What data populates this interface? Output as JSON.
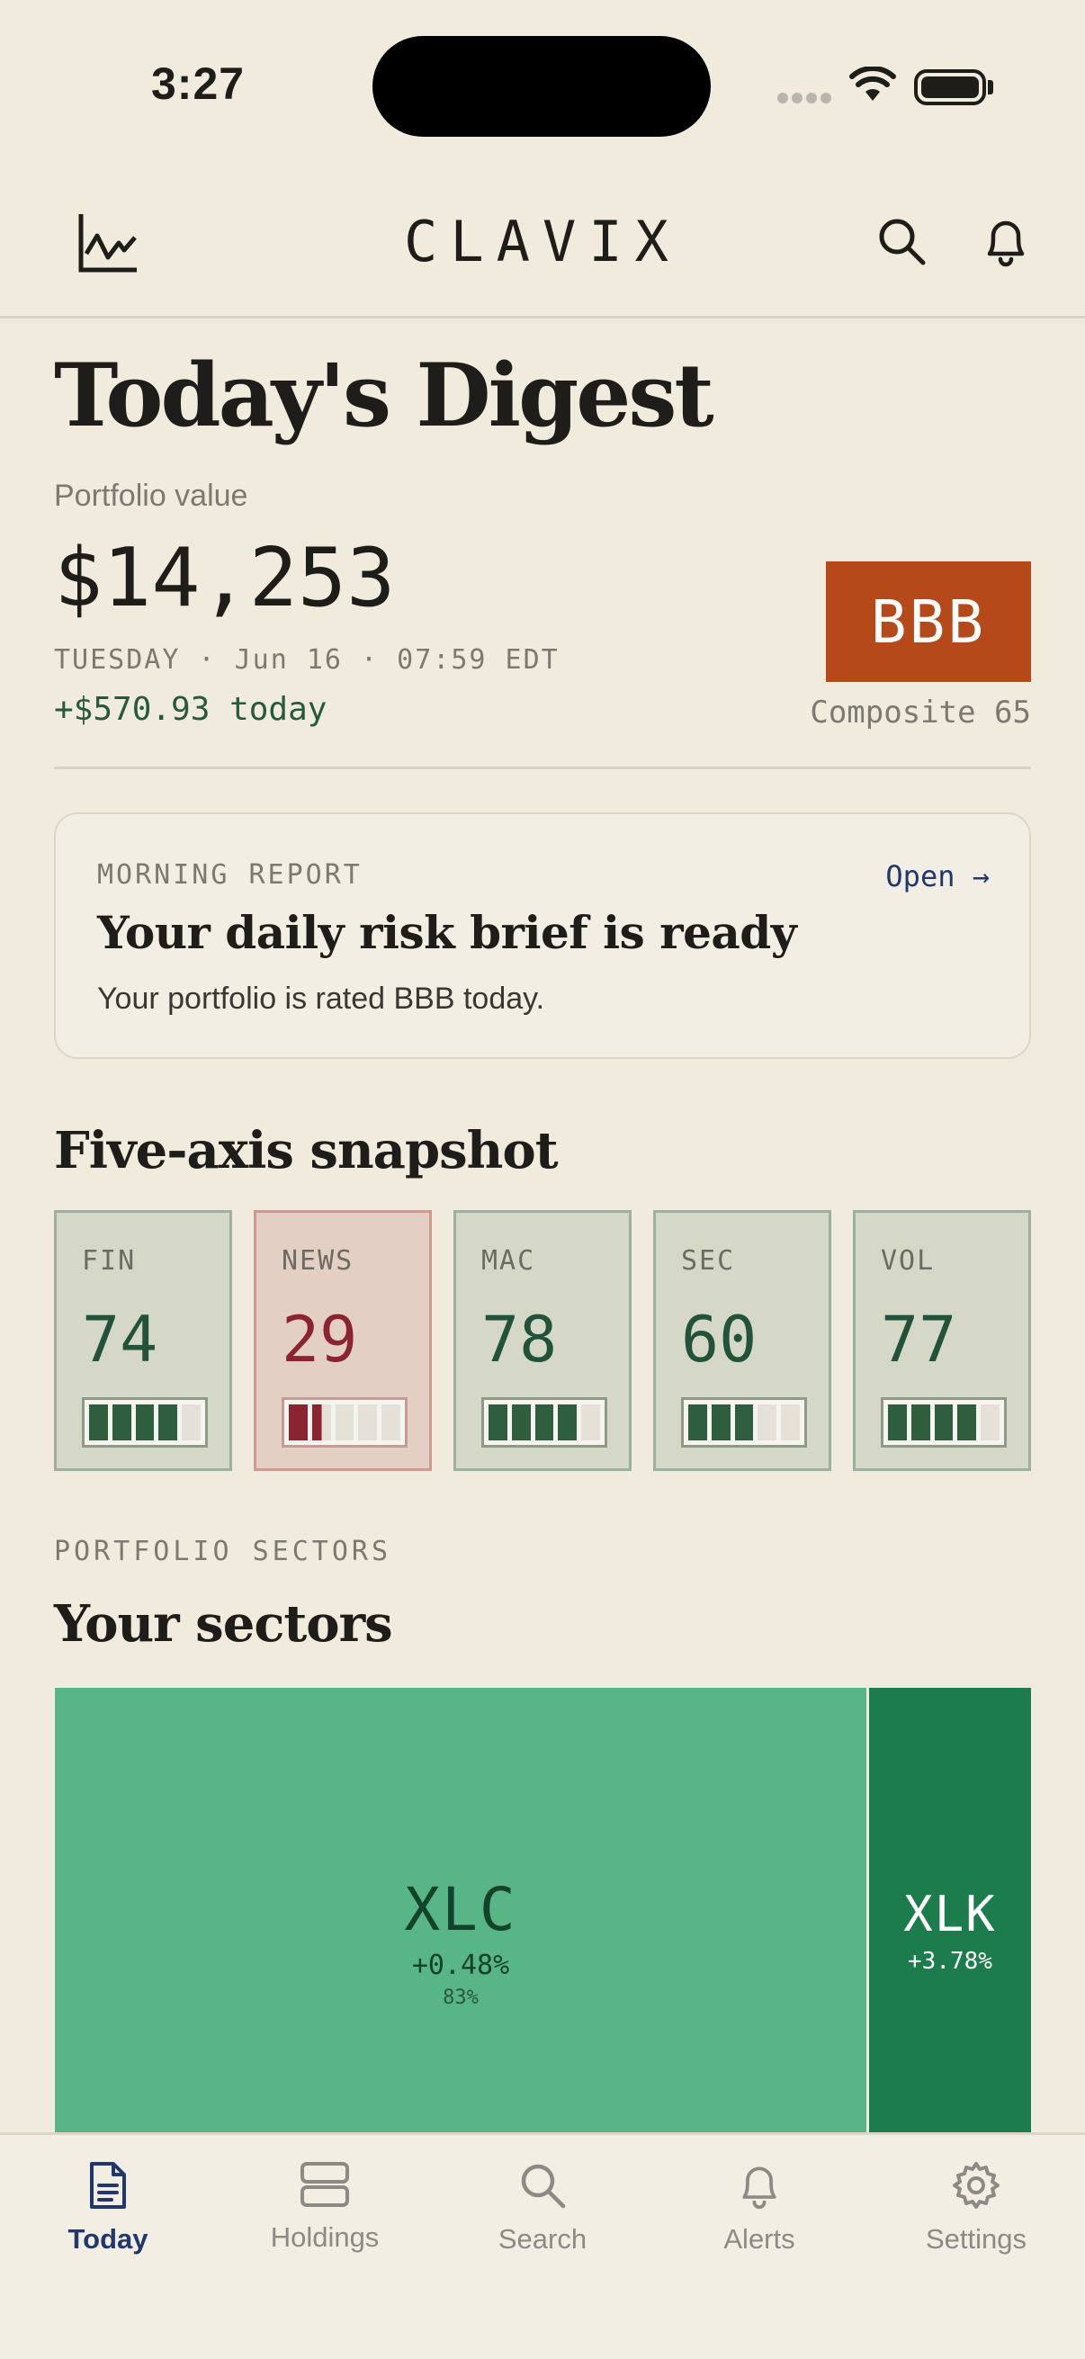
{
  "status_bar": {
    "time": "3:27"
  },
  "header": {
    "brand": "CLAVIX"
  },
  "digest": {
    "title": "Today's Digest",
    "portfolio_label": "Portfolio value",
    "portfolio_value": "$14,253",
    "date_line": "TUESDAY · Jun 16 · 07:59 EDT",
    "change_today": "+$570.93 today",
    "rating": "BBB",
    "composite": "Composite 65"
  },
  "report": {
    "kicker": "MORNING REPORT",
    "open_label": "Open →",
    "title": "Your daily risk brief is ready",
    "text": "Your portfolio is rated BBB today."
  },
  "snapshot": {
    "title": "Five-axis snapshot",
    "axes": [
      {
        "label": "FIN",
        "value": "74",
        "level": 0.74
      },
      {
        "label": "NEWS",
        "value": "29",
        "level": 0.29
      },
      {
        "label": "MAC",
        "value": "78",
        "level": 0.78
      },
      {
        "label": "SEC",
        "value": "60",
        "level": 0.6
      },
      {
        "label": "VOL",
        "value": "77",
        "level": 0.77
      }
    ]
  },
  "sectors": {
    "kicker": "PORTFOLIO SECTORS",
    "title": "Your sectors",
    "tiles": [
      {
        "symbol": "XLC",
        "change": "+0.48%",
        "weight": "83%"
      },
      {
        "symbol": "XLK",
        "change": "+3.78%"
      }
    ]
  },
  "tabs": [
    {
      "label": "Today"
    },
    {
      "label": "Holdings"
    },
    {
      "label": "Search"
    },
    {
      "label": "Alerts"
    },
    {
      "label": "Settings"
    }
  ],
  "colors": {
    "background": "#F0EBDD",
    "accent_navy": "#22386A",
    "rating_orange": "#B5491A",
    "positive_green": "#275A3A",
    "negative_red": "#8A2431"
  }
}
